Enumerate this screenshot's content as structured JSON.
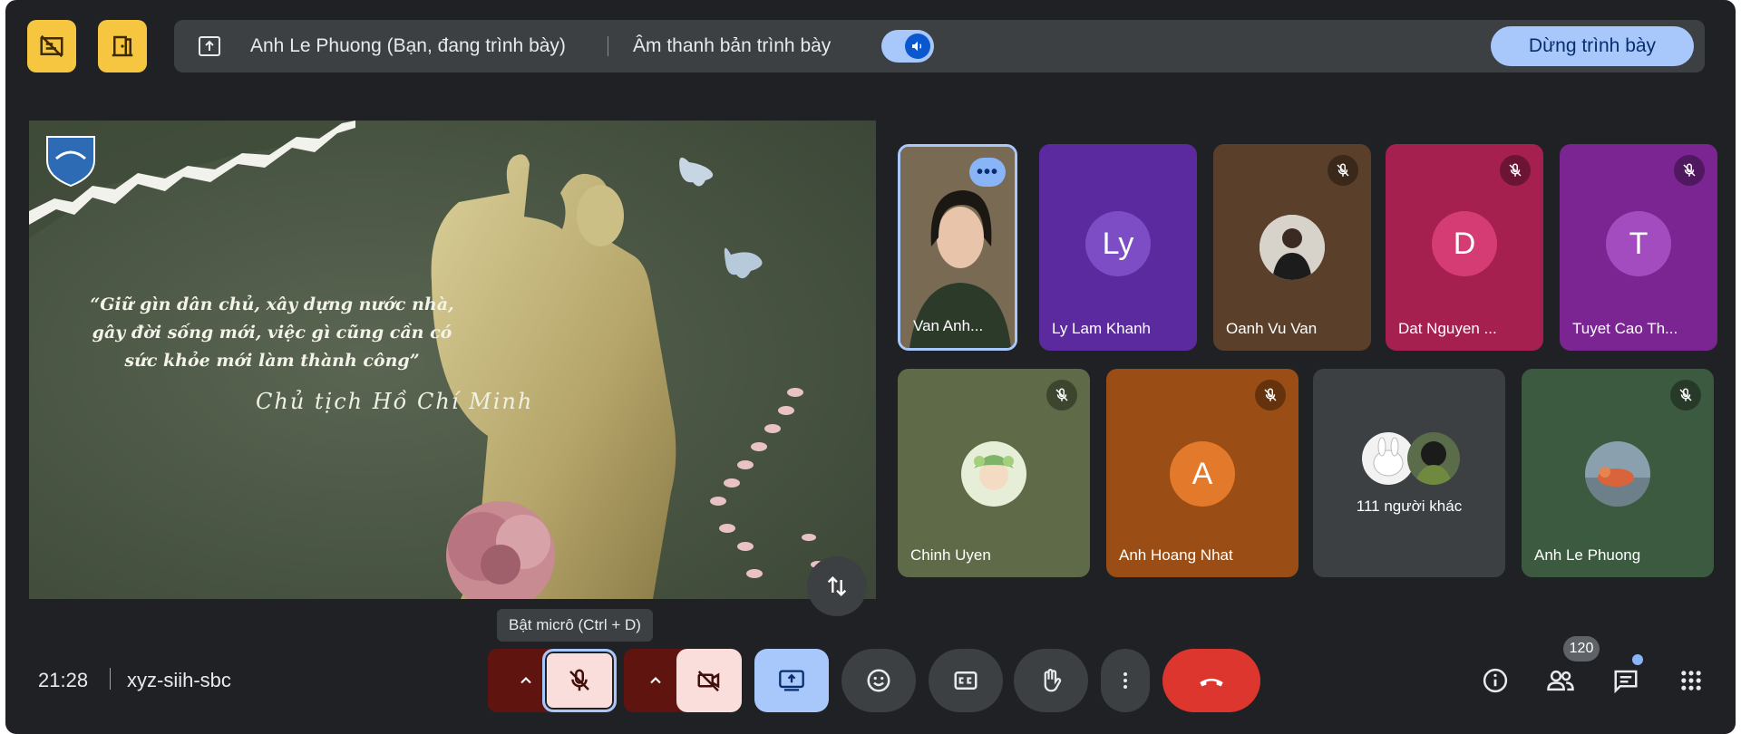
{
  "top_bar": {
    "presenter": "Anh Le Phuong (Bạn, đang trình bày)",
    "audio_label": "Âm thanh bản trình bày",
    "stop_label": "Dừng trình bày",
    "icons": [
      "layout-off-icon",
      "exit-door-icon",
      "present-screen-icon",
      "volume-icon"
    ]
  },
  "slide": {
    "quote": "“Giữ gìn dân chủ, xây dựng nước nhà, gây đời sống mới, việc gì cũng cần có sức khỏe mới làm thành công”",
    "signature": "Chủ tịch Hồ Chí Minh"
  },
  "participants": [
    {
      "name": "Van Anh...",
      "type": "video"
    },
    {
      "name": "Ly Lam Khanh",
      "initials": "Ly",
      "muted": false,
      "bg": "#5b2a9e",
      "avatar": "#7c4dc4"
    },
    {
      "name": "Oanh Vu Van",
      "type": "photo",
      "muted": true,
      "bg": "#5a3f2a"
    },
    {
      "name": "Dat Nguyen ...",
      "initials": "D",
      "muted": true,
      "bg": "#a5204f",
      "avatar": "#d63c74"
    },
    {
      "name": "Tuyet Cao Th...",
      "initials": "T",
      "muted": true,
      "bg": "#7a2592",
      "avatar": "#a34cbf"
    },
    {
      "name": "Chinh Uyen",
      "type": "photo",
      "muted": true,
      "bg": "#5f6a48"
    },
    {
      "name": "Anh Hoang Nhat",
      "initials": "A",
      "muted": true,
      "bg": "#9a4d14",
      "avatar": "#e37a2b"
    },
    {
      "name": "111 người khác",
      "type": "others"
    },
    {
      "name": "Anh Le Phuong",
      "type": "photo",
      "muted": true,
      "bg": "#3c5a40"
    }
  ],
  "bottom": {
    "time": "21:28",
    "meeting_code": "xyz-siih-sbc",
    "tooltip": "Bật micrô (Ctrl + D)",
    "people_count": "120"
  },
  "colors": {
    "accent_yellow": "#f6c641",
    "accent_blue": "#a8c7fa",
    "end_call": "#dc362e",
    "mic_off_bg": "#f9dedc",
    "mic_off_chevron_bg": "#601410"
  }
}
